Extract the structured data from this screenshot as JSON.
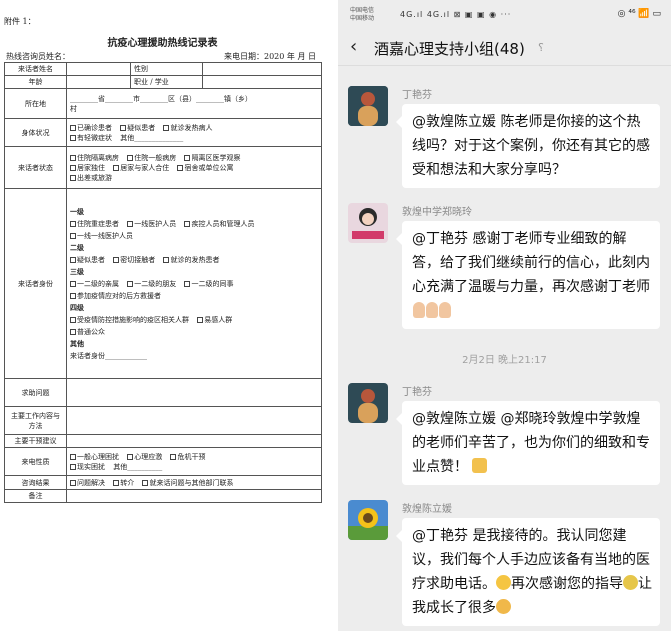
{
  "form": {
    "attachment": "附件 1：",
    "title": "抗疫心理援助热线记录表",
    "counselor": "热线咨询员姓名：",
    "date": "来电日期：2020 年 月 日",
    "rows": {
      "caller_name": "来话者姓名",
      "gender": "性别",
      "age": "年龄",
      "occupation": "职业 / 学业",
      "location": "所在地",
      "location_fields": "________省________市________区（县）________镇（乡）",
      "location_village": "村",
      "health": "身体状况",
      "health_opts": [
        "已确诊患者",
        "疑似患者",
        "就诊发热病人",
        "有轻微症状"
      ],
      "health_other": "其他",
      "state": "来话者状态",
      "state_opts": [
        "住院隔离病房",
        "住院一般病房",
        "隔离区医学观察",
        "居家独住",
        "居家与家人合住",
        "宿舍或单位公寓",
        "出差或旅游"
      ],
      "identity": "来话者身份",
      "level1": "一级",
      "level1_opts": [
        "住院重症患者",
        "一线医护人员",
        "疾控人员和管理人员",
        "一线一线医护人员"
      ],
      "level2": "二级",
      "level2_opts": [
        "疑似患者",
        "密切接触者",
        "就诊的发热患者"
      ],
      "level3": "三级",
      "level3_opts": [
        "一二级的亲属",
        "一二级的朋友",
        "一二级的同事",
        "参加疫情应对的后方救援者"
      ],
      "level4": "四级",
      "level4_opts": [
        "受疫情防控措施影响的疫区相关人群",
        "易感人群",
        "普通公众"
      ],
      "other": "其他",
      "other_identity": "来话者身份",
      "help": "求助问题",
      "work": "主要工作内容与方法",
      "suggest": "主要干预建议",
      "nature": "来电性质",
      "nature_opts": [
        "一般心理困扰",
        "心理应激",
        "危机干预",
        "现实困扰"
      ],
      "nature_other": "其他",
      "result": "咨询结果",
      "result_opts": [
        "问题解决",
        "转介",
        "就来话问题与其他部门联系"
      ],
      "note": "备注"
    }
  },
  "phone": {
    "carrier1": "中国电信",
    "carrier2": "中国移动",
    "signal": "4G.ıl 4G.ıl ⊠ ▣ ▣ ◉ ···",
    "status_right": "◎ ⁴⁶ 📶 ▭",
    "chat_title": "酒嘉心理支持小组(48)",
    "time_sep": "2月2日 晚上21:17",
    "messages": [
      {
        "sender": "丁艳芬",
        "text": "@敦煌陈立媛  陈老师是你接的这个热线吗？对于这个案例，你还有其它的感受和想法和大家分享吗？"
      },
      {
        "sender": "敦煌中学郑晓玲",
        "text": "@丁艳芬  感谢丁老师专业细致的解答，给了我们继续前行的信心，此刻内心充满了温暖与力量，再次感谢丁老师"
      },
      {
        "sender": "丁艳芬",
        "text": "@敦煌陈立媛  @郑晓玲敦煌中学敦煌的老师们辛苦了，也为你们的细致和专业点赞！"
      },
      {
        "sender": "敦煌陈立媛",
        "text1": "@丁艳芬  是我接待的。我认同您建议，我们每个人手边应该备有当地的医疗求助电话。",
        "text2": "再次感谢您的指导",
        "text3": "让我成长了很多"
      }
    ]
  }
}
